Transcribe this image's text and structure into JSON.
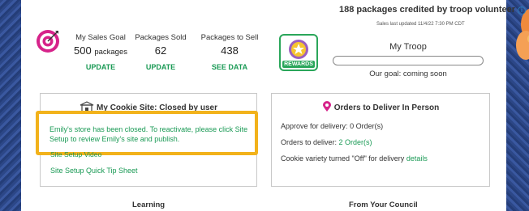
{
  "header": {
    "credited_text": "188 packages credited by troop volunteer",
    "info_icon": "info-icon",
    "last_updated": "Sales last updated 11/4/22 7:30 PM CDT"
  },
  "stats": {
    "sales_goal": {
      "label": "My Sales Goal",
      "value": "500",
      "unit": "packages",
      "link": "UPDATE"
    },
    "packages_sold": {
      "label": "Packages Sold",
      "value": "62",
      "link": "UPDATE"
    },
    "packages_to_sell": {
      "label": "Packages to Sell",
      "value": "438",
      "link": "SEE DATA"
    }
  },
  "rewards": {
    "label": "REWARDS",
    "icon": "rewards-star-icon"
  },
  "troop": {
    "title": "My Troop",
    "progress": 0,
    "goal_text": "Our goal: coming soon"
  },
  "cookie_site": {
    "title": "My Cookie Site: Closed by user",
    "icon": "storefront-icon",
    "closed_message": "Emily's store has been closed. To reactivate, please click Site Setup to review Emily's site and publish.",
    "video_link": "Site Setup Video",
    "quick_tip_link": "Site Setup Quick Tip Sheet"
  },
  "deliveries": {
    "title": "Orders to Deliver In Person",
    "icon": "location-pin-icon",
    "approve_label": "Approve for delivery:",
    "approve_value": "0 Order(s)",
    "deliver_label": "Orders to deliver:",
    "deliver_value": "2 Order(s)",
    "variety_text": "Cookie variety turned \"Off\" for delivery",
    "details_link": "details"
  },
  "sections": {
    "learning": "Learning",
    "council": "From Your Council"
  },
  "colors": {
    "accent_green": "#1a9a55",
    "highlight": "#f2b21b",
    "target_magenta": "#d6238a",
    "background_blue": "#2f4a8a"
  }
}
